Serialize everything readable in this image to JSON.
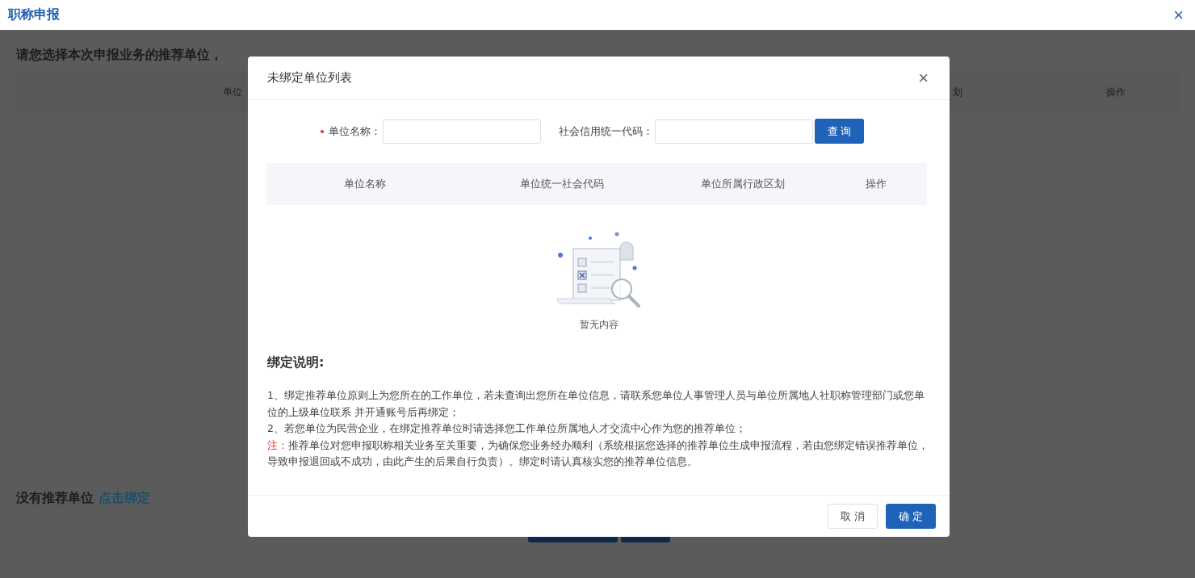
{
  "page": {
    "title": "职称申报",
    "close": "×"
  },
  "background": {
    "prompt": "请您选择本次申报业务的推荐单位，",
    "table_headers": [
      "单位",
      "划",
      "操作"
    ],
    "no_unit_text": "没有推荐单位",
    "bind_link": "点击绑定"
  },
  "dialog": {
    "title": "未绑定单位列表",
    "close": "×",
    "form": {
      "fields": [
        {
          "label": "单位名称：",
          "required": true
        },
        {
          "label": "社会信用统一代码：",
          "required": false
        }
      ],
      "search_button": "查 询"
    },
    "table": {
      "columns": [
        "单位名称",
        "单位统一社会代码",
        "单位所属行政区划",
        "操作"
      ],
      "empty_text": "暂无内容"
    },
    "notes": {
      "title": "绑定说明:",
      "items": [
        {
          "kind": "plain",
          "text": "1、绑定推荐单位原则上为您所在的工作单位，若未查询出您所在单位信息，请联系您单位人事管理人员与单位所属地人社职称管理部门或您单位的上级单位联系 并开通账号后再绑定；"
        },
        {
          "kind": "plain",
          "text": "2、若您单位为民营企业，在绑定推荐单位时请选择您工作单位所属地人才交流中心作为您的推荐单位；"
        },
        {
          "kind": "warning",
          "prefix": "注：",
          "text": "推荐单位对您申报职称相关业务至关重要，为确保您业务经办顺利（系统根据您选择的推荐单位生成申报流程，若由您绑定错误推荐单位，导致申报退回或不成功，由此产生的后果自行负责）。绑定时请认真核实您的推荐单位信息。"
        }
      ]
    },
    "buttons": [
      {
        "label": "取 消",
        "kind": "secondary"
      },
      {
        "label": "确 定",
        "kind": "primary"
      }
    ]
  }
}
